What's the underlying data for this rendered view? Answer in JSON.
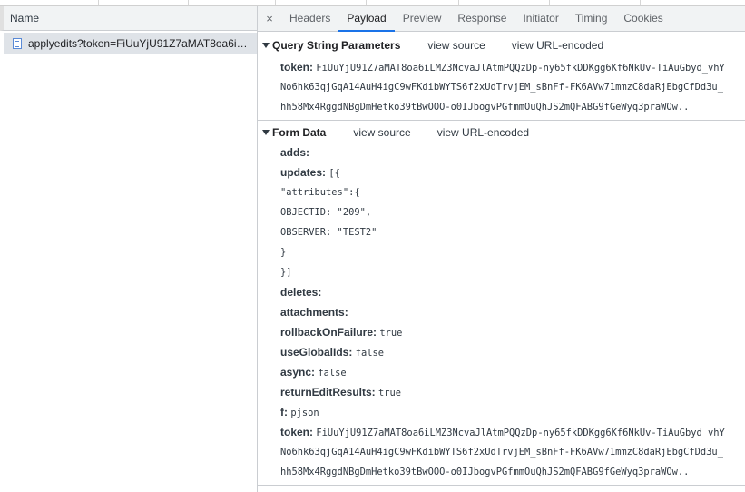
{
  "left": {
    "column_header": "Name",
    "request_name": "applyedits?token=FiUuYjU91Z7aMAT8oa6iL..."
  },
  "tabs": {
    "close_symbol": "×",
    "items": [
      "Headers",
      "Payload",
      "Preview",
      "Response",
      "Initiator",
      "Timing",
      "Cookies"
    ],
    "active": "Payload"
  },
  "query": {
    "title": "Query String Parameters",
    "view_source": "view source",
    "view_url_encoded": "view URL-encoded",
    "token_key": "token:",
    "token_lines": [
      "FiUuYjU91Z7aMAT8oa6iLMZ3NcvaJlAtmPQQzDp-ny65fkDDKgg6Kf6NkUv-TiAuGbyd_vhY",
      "No6hk63qjGqA14AuH4igC9wFKdibWYTS6f2xUdTrvjEM_sBnFf-FK6AVw71mmzC8daRjEbgCfDd3u_",
      "hh58Mx4RggdNBgDmHetko39tBwOOO-o0IJbogvPGfmmOuQhJS2mQFABG9fGeWyq3praWOw.."
    ]
  },
  "form": {
    "title": "Form Data",
    "view_source": "view source",
    "view_url_encoded": "view URL-encoded",
    "adds_key": "adds:",
    "updates_key": "updates:",
    "updates_lines": [
      "[{",
      "\"attributes\":{",
      "OBJECTID: \"209\",",
      "OBSERVER: \"TEST2\"",
      "}",
      "}]"
    ],
    "deletes_key": "deletes:",
    "attachments_key": "attachments:",
    "rollback_key": "rollbackOnFailure:",
    "rollback_val": "true",
    "useglobal_key": "useGlobalIds:",
    "useglobal_val": "false",
    "async_key": "async:",
    "async_val": "false",
    "return_key": "returnEditResults:",
    "return_val": "true",
    "f_key": "f:",
    "f_val": "pjson",
    "token_key": "token:",
    "token_lines": [
      "FiUuYjU91Z7aMAT8oa6iLMZ3NcvaJlAtmPQQzDp-ny65fkDDKgg6Kf6NkUv-TiAuGbyd_vhY",
      "No6hk63qjGqA14AuH4igC9wFKdibWYTS6f2xUdTrvjEM_sBnFf-FK6AVw71mmzC8daRjEbgCfDd3u_",
      "hh58Mx4RggdNBgDmHetko39tBwOOO-o0IJbogvPGfmmOuQhJS2mQFABG9fGeWyq3praWOw.."
    ]
  }
}
